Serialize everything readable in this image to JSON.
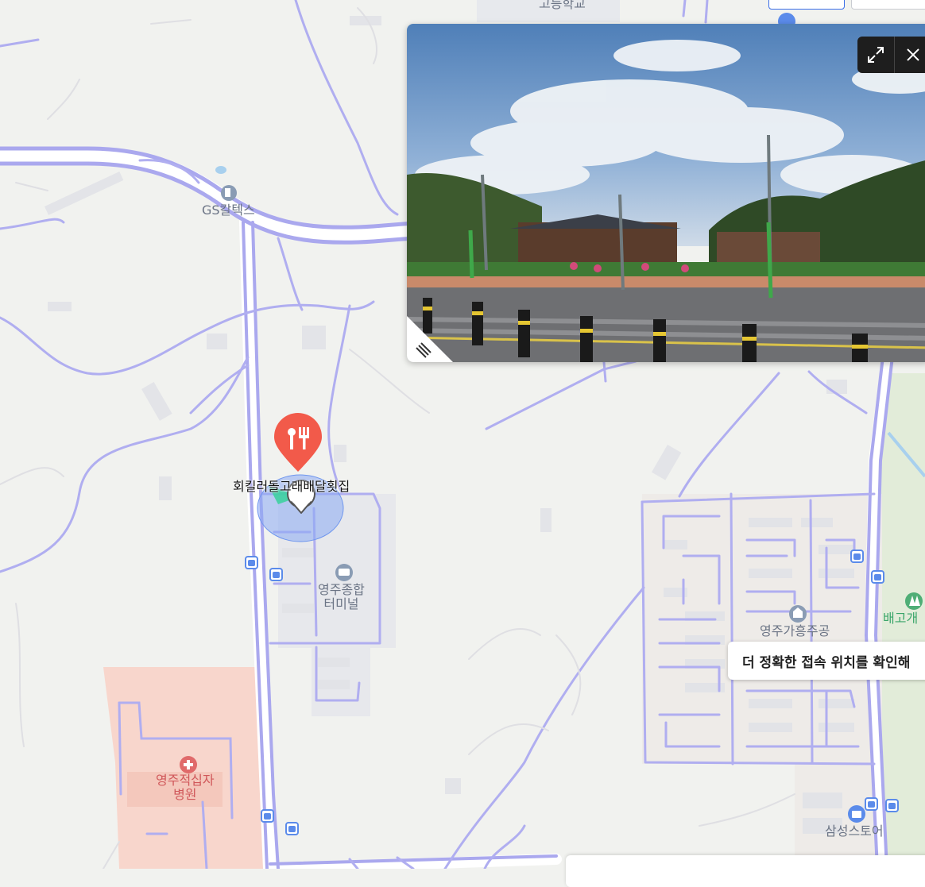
{
  "map": {
    "labels": {
      "school": "고등학교",
      "gas_station": "GS칼텍스",
      "bus_terminal": "영주종합\n터미널",
      "hospital": "영주적십자\n병원",
      "apartment": "영주가흥주공",
      "park": "배고개",
      "store": "삼성스토어"
    },
    "pin": {
      "category": "restaurant",
      "icon": "fork-knife-icon",
      "label": "회킬러돌고래배달횟집",
      "color": "#f25a4a"
    },
    "colors": {
      "road": "#aaa8ee",
      "background": "#f1f2ef",
      "hospital_area": "#f8d6cc",
      "green_area": "#e2ecd9"
    }
  },
  "panorama": {
    "expand_icon": "expand-icon",
    "close_icon": "close-icon",
    "menu_icon": "menu-icon"
  },
  "tooltip": {
    "text": "더 정확한 접속 위치를 확인해"
  }
}
